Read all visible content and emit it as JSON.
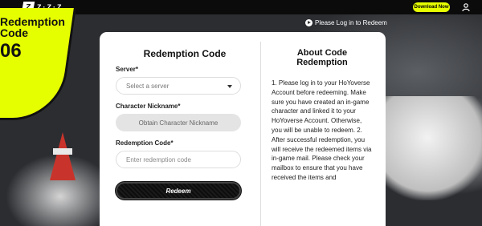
{
  "topbar": {
    "logo_mark": "Z",
    "logo_text": "Z·Z·Z",
    "download_label": "Download Now"
  },
  "login_link": "Please Log in to Redeem",
  "banner": {
    "line1": "Redemption",
    "line2": "Code",
    "code": "06"
  },
  "form": {
    "title": "Redemption Code",
    "server_label": "Server*",
    "server_value": "Select a server",
    "nickname_label": "Character Nickname*",
    "nickname_value": "Obtain Character Nickname",
    "code_label": "Redemption Code*",
    "code_placeholder": "Enter redemption code",
    "redeem_label": "Redeem"
  },
  "about": {
    "title": "About Code Redemption",
    "body": "1. Please log in to your HoYoverse Account before redeeming. Make sure you have created an in-game character and linked it to your HoYoverse Account. Otherwise, you will be unable to redeem. 2. After successful redemption, you will receive the redeemed items via in-game mail. Please check your mailbox to ensure that you have received the items and"
  },
  "colors": {
    "accent": "#e6ff00",
    "topbar": "#0b0b0b"
  }
}
